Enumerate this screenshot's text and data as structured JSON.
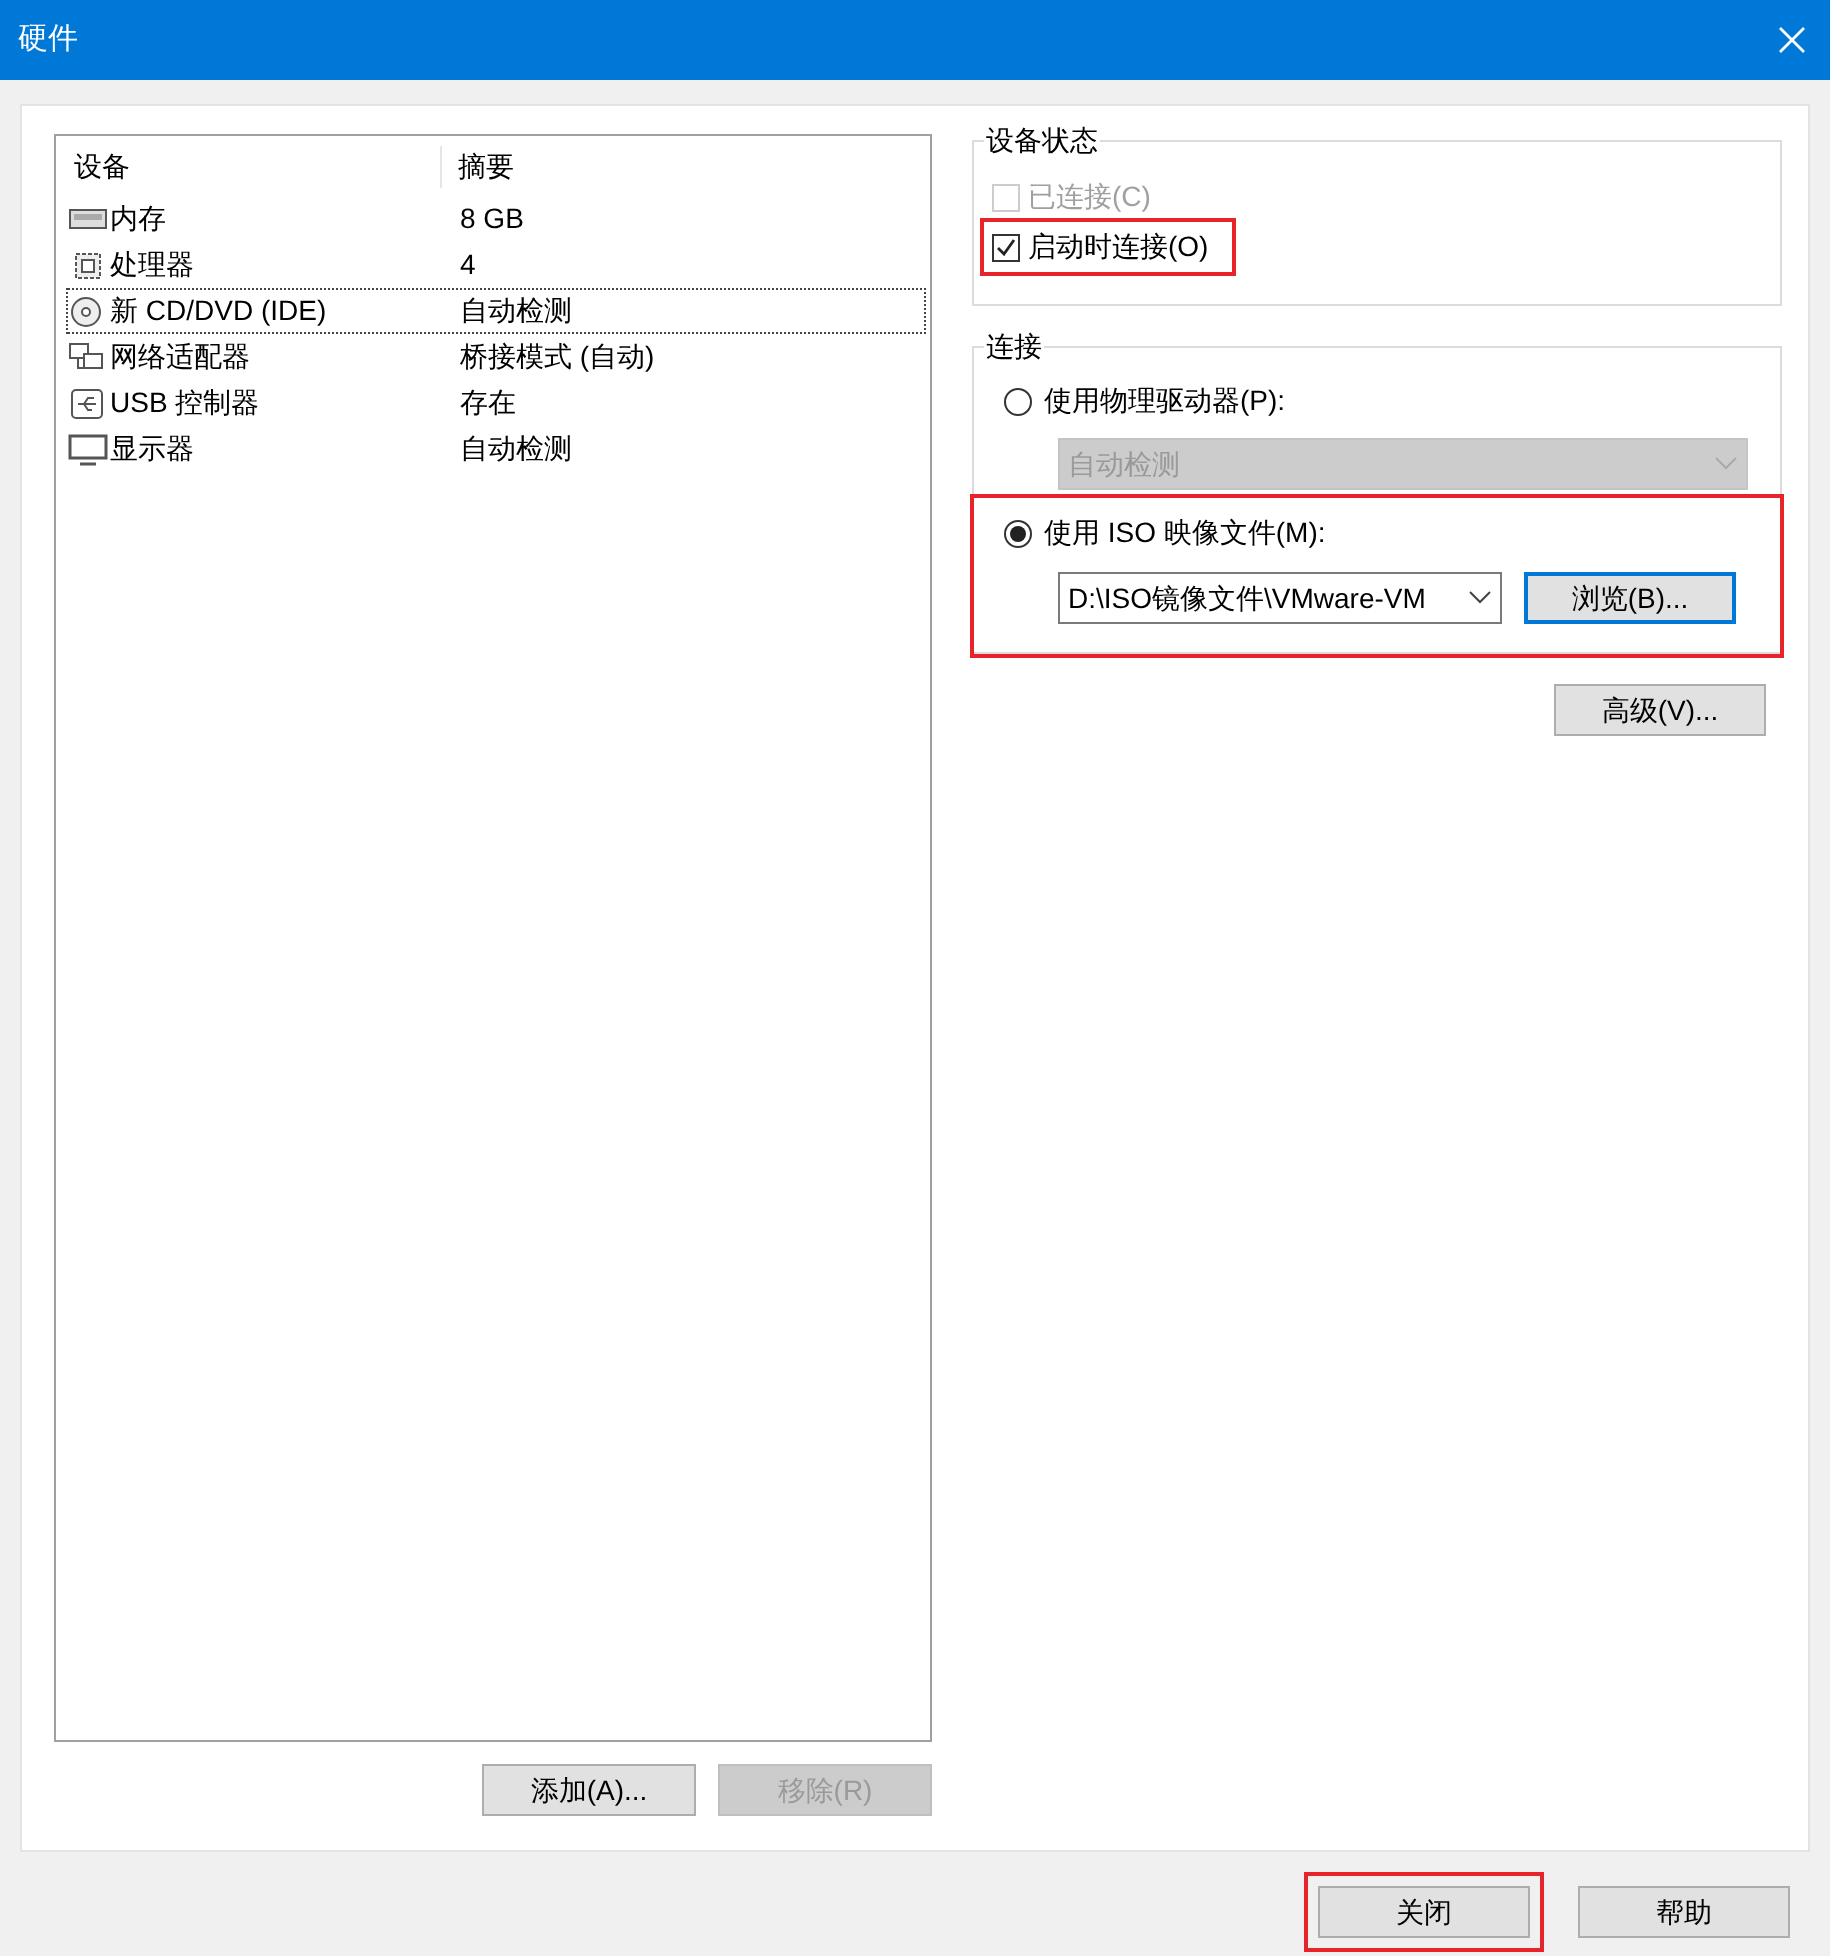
{
  "window": {
    "title": "硬件"
  },
  "device_table": {
    "columns": [
      "设备",
      "摘要"
    ],
    "rows": [
      {
        "kind": "memory",
        "device": "内存",
        "summary": "8 GB",
        "selected": false
      },
      {
        "kind": "cpu",
        "device": "处理器",
        "summary": "4",
        "selected": false
      },
      {
        "kind": "disc",
        "device": "新 CD/DVD (IDE)",
        "summary": "自动检测",
        "selected": true
      },
      {
        "kind": "network",
        "device": "网络适配器",
        "summary": "桥接模式 (自动)",
        "selected": false
      },
      {
        "kind": "usb",
        "device": "USB 控制器",
        "summary": "存在",
        "selected": false
      },
      {
        "kind": "display",
        "device": "显示器",
        "summary": "自动检测",
        "selected": false
      }
    ]
  },
  "list_buttons": [
    {
      "label": "添加(A)...",
      "disabled": false
    },
    {
      "label": "移除(R)",
      "disabled": true
    }
  ],
  "device_status": {
    "title": "设备状态",
    "checkboxes": [
      {
        "label": "已连接(C)",
        "checked": false,
        "disabled": true,
        "highlighted": false
      },
      {
        "label": "启动时连接(O)",
        "checked": true,
        "disabled": false,
        "highlighted": true
      }
    ]
  },
  "connection": {
    "title": "连接",
    "physical": {
      "label": "使用物理驱动器(P):",
      "selected": false,
      "dropdown": {
        "value": "自动检测",
        "disabled": true
      }
    },
    "iso": {
      "label": "使用 ISO 映像文件(M):",
      "selected": true,
      "highlighted": true,
      "path": "D:\\ISO镜像文件\\VMware-VM",
      "browse": "浏览(B)..."
    }
  },
  "advanced_button": "高级(V)...",
  "footer_buttons": [
    {
      "label": "关闭",
      "highlighted": true
    },
    {
      "label": "帮助",
      "highlighted": false
    }
  ]
}
